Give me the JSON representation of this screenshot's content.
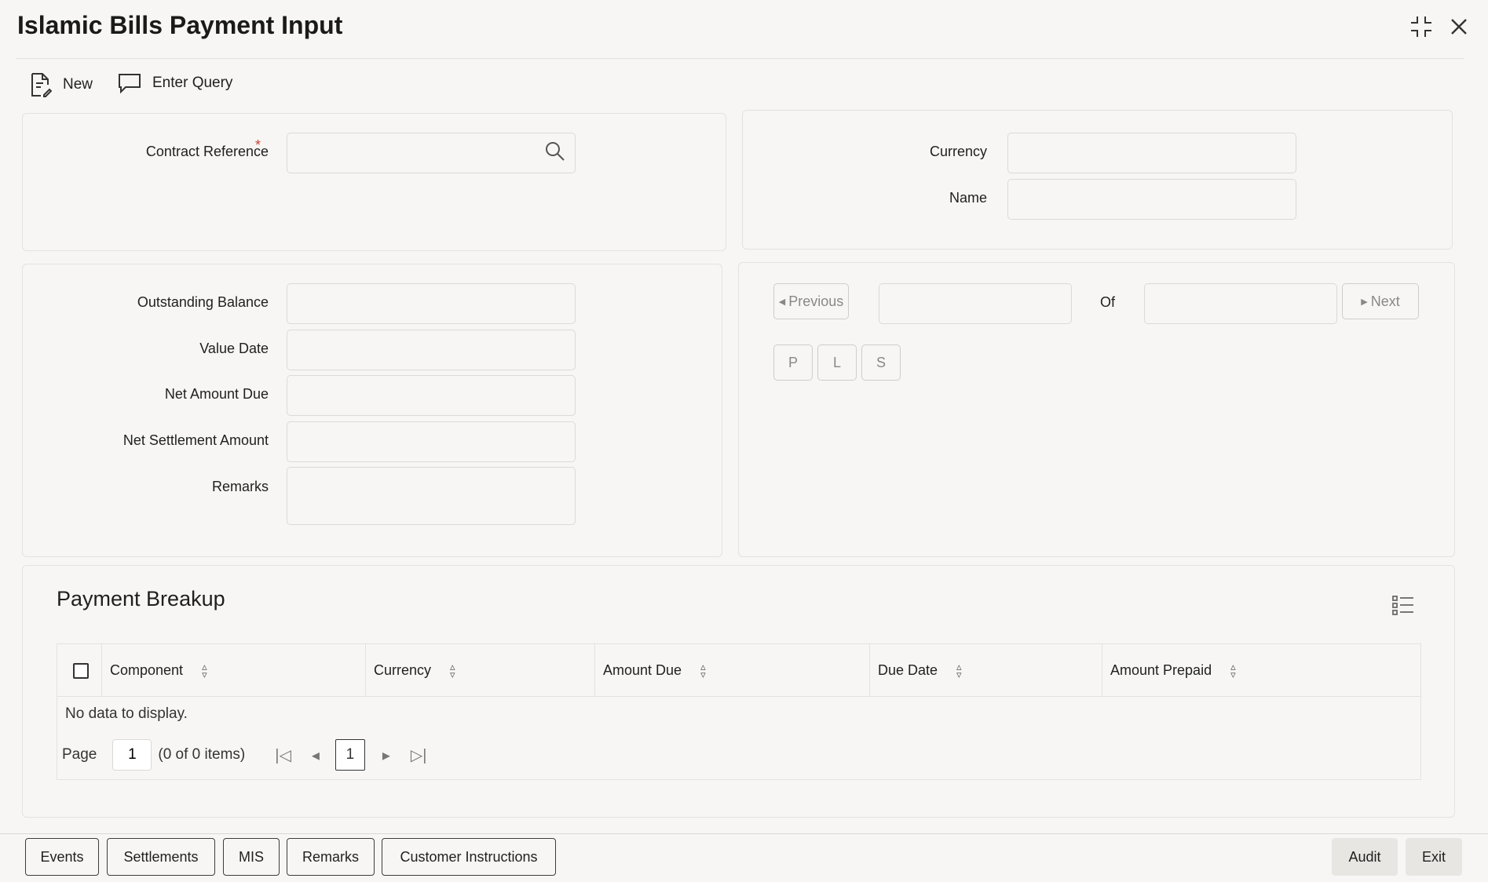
{
  "window": {
    "title": "Islamic Bills Payment Input"
  },
  "toolbar": {
    "new_label": "New",
    "enter_query_label": "Enter Query"
  },
  "header": {
    "contract_reference_label": "Contract Reference",
    "required_mark": "*",
    "currency_label": "Currency",
    "name_label": "Name"
  },
  "details": {
    "outstanding_balance_label": "Outstanding Balance",
    "value_date_label": "Value Date",
    "net_amount_due_label": "Net Amount Due",
    "net_settlement_amount_label": "Net Settlement Amount",
    "remarks_label": "Remarks"
  },
  "navigator": {
    "previous_label": "Previous",
    "of_label": "Of",
    "next_label": "Next",
    "p_label": "P",
    "l_label": "L",
    "s_label": "S"
  },
  "payment_breakup": {
    "title": "Payment Breakup",
    "columns": [
      "Component",
      "Currency",
      "Amount Due",
      "Due Date",
      "Amount Prepaid"
    ],
    "empty_message": "No data to display.",
    "pager": {
      "page_label": "Page",
      "page_value": "1",
      "items_summary": "(0 of 0 items)",
      "current_page": "1"
    }
  },
  "footer": {
    "events": "Events",
    "settlements": "Settlements",
    "mis": "MIS",
    "remarks": "Remarks",
    "customer_instructions": "Customer Instructions",
    "audit": "Audit",
    "exit": "Exit"
  }
}
